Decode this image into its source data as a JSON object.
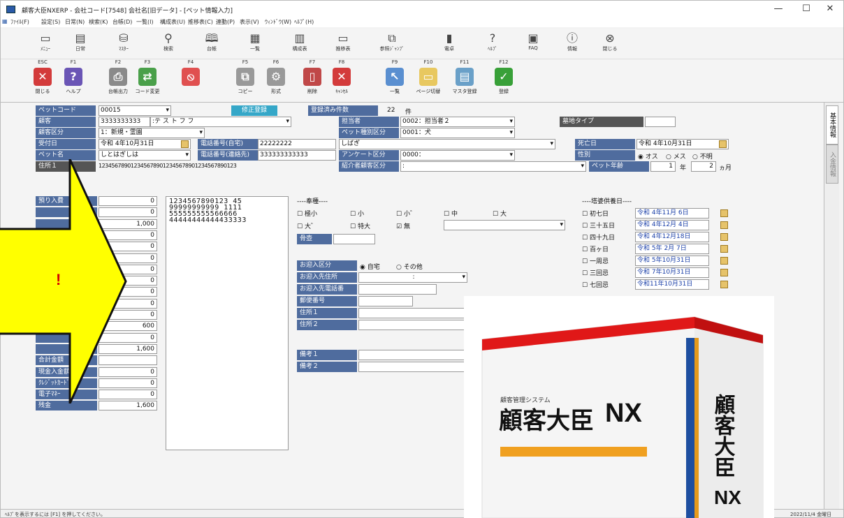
{
  "window": {
    "title": "顧客大臣NXERP - 会社コード[7548] 会社名[旧データ] - [ペット情報入力]",
    "min": "—",
    "max": "☐",
    "close": "✕"
  },
  "menu": [
    "ﾌｧｲﾙ(F)",
    "設定(S)",
    "日常(N)",
    "検索(K)",
    "台帳(D)",
    "一覧(I)",
    "構成表(U)",
    "推移表(C)",
    "連動(P)",
    "表示(V)",
    "ｳｨﾝﾄﾞｳ(W)",
    "ﾍﾙﾌﾟ(H)"
  ],
  "toolbar": [
    {
      "label": "ﾒﾆｭｰ",
      "icon": "menu-icon",
      "glyph": "▭"
    },
    {
      "label": "日常",
      "icon": "daily-icon",
      "glyph": "▤"
    },
    {
      "label": "ﾏｽﾀｰ",
      "icon": "master-icon",
      "glyph": "⛁"
    },
    {
      "label": "検索",
      "icon": "search-icon",
      "glyph": "⚲"
    },
    {
      "label": "台帳",
      "icon": "ledger-icon",
      "glyph": "🕮"
    },
    {
      "label": "一覧",
      "icon": "list-icon",
      "glyph": "▦"
    },
    {
      "label": "構成表",
      "icon": "structure-icon",
      "glyph": "▥"
    },
    {
      "label": "推移表",
      "icon": "trend-icon",
      "glyph": "▭"
    },
    {
      "label": "参照ｼﾞｬﾝﾌﾟ",
      "icon": "jump-icon",
      "glyph": "⧉"
    },
    {
      "label": "電卓",
      "icon": "calculator-icon",
      "glyph": "▮"
    },
    {
      "label": "ﾍﾙﾌﾟ",
      "icon": "help-icon",
      "glyph": "?"
    },
    {
      "label": "FAQ",
      "icon": "faq-icon",
      "glyph": "▣"
    },
    {
      "label": "情報",
      "icon": "info-icon",
      "glyph": "ⓘ"
    },
    {
      "label": "閉じる",
      "icon": "close-circle-icon",
      "glyph": "⊗"
    }
  ],
  "fkeys": [
    {
      "key": "ESC",
      "label": "閉じる",
      "icon": "exit-icon",
      "color": "#d33b3b",
      "glyph": "✕"
    },
    {
      "key": "F1",
      "label": "ヘルプ",
      "icon": "help-icon",
      "color": "#6a55b5",
      "glyph": "?"
    },
    {
      "key": "F2",
      "label": "台帳出力",
      "icon": "print-icon",
      "color": "#8a8a8a",
      "glyph": "⎙"
    },
    {
      "key": "F3",
      "label": "コード変更",
      "icon": "code-change-icon",
      "color": "#4aa04a",
      "glyph": "⇄"
    },
    {
      "key": "F4",
      "label": "",
      "icon": "prohibit-icon",
      "color": "#e05050",
      "glyph": "⦸"
    },
    {
      "key": "F5",
      "label": "コピー",
      "icon": "copy-icon",
      "color": "#999",
      "glyph": "⧉"
    },
    {
      "key": "F6",
      "label": "形式",
      "icon": "format-icon",
      "color": "#999",
      "glyph": "⚙"
    },
    {
      "key": "F7",
      "label": "削除",
      "icon": "delete-icon",
      "color": "#c04848",
      "glyph": "▯"
    },
    {
      "key": "F8",
      "label": "ｷｬﾝｾﾙ",
      "icon": "cancel-icon",
      "color": "#d33b3b",
      "glyph": "✕"
    },
    {
      "key": "F9",
      "label": "一覧",
      "icon": "list-view-icon",
      "color": "#5a8fd0",
      "glyph": "↖"
    },
    {
      "key": "F10",
      "label": "ページ切替",
      "icon": "page-switch-icon",
      "color": "#e8c860",
      "glyph": "▭"
    },
    {
      "key": "F11",
      "label": "マスタ登録",
      "icon": "master-register-icon",
      "color": "#6aa0c8",
      "glyph": "▤"
    },
    {
      "key": "F12",
      "label": "登録",
      "icon": "register-check-icon",
      "color": "#38a038",
      "glyph": "✓"
    }
  ],
  "form": {
    "pet_code_label": "ペットコード",
    "pet_code": "00015",
    "correction_badge": "修正登録",
    "registered_count_label": "登録済み件数",
    "registered_count": "22",
    "count_unit": "件",
    "customer_label": "顧客",
    "customer_code": "3333333333",
    "customer_name": ":テ ス ト フ フ",
    "staff_label": "担当者",
    "staff": "0002：担当者２",
    "grave_type_label": "墓地タイプ",
    "customer_class_label": "顧客区分",
    "customer_class": "1：新規・霊園",
    "pet_kind_label": "ペット種別区分",
    "pet_kind": "0001：犬",
    "reception_label": "受付日",
    "reception": "令和 4年10月31日",
    "phone_home_label": "電話番号(自宅)",
    "phone_home": "22222222",
    "breed": "しばぎ",
    "death_label": "死亡日",
    "death": "令和 4年10月31日",
    "pet_name_label": "ペット名",
    "pet_name": "しとはぎしは",
    "phone_contact_label": "電話番号(連絡先)",
    "phone_contact": "333333333333",
    "survey_label": "アンケート区分",
    "survey": "0000：",
    "sex_label": "性別",
    "sex_options": [
      "オス",
      "メス",
      "不明"
    ],
    "address1_label": "住所１",
    "address1": "1234567890123456789012345678901234567890123",
    "referrer_label": "紹介者顧客区分",
    "referrer": ":",
    "age_label": "ペット年齢",
    "age_years": "1",
    "age_years_unit": "年",
    "age_months": "2",
    "age_months_unit": "ヵ月"
  },
  "amounts": {
    "labels": [
      "預り入費",
      "",
      "",
      "",
      "",
      "",
      "",
      "",
      "",
      "",
      "",
      "",
      "",
      "",
      "合計金額",
      "現金入金額",
      "ｸﾚｼﾞｯﾄｶｰﾄﾞ",
      "電子ﾏﾈｰ",
      "残金"
    ],
    "values": [
      "0",
      "0",
      "1,000",
      "0",
      "0",
      "0",
      "0",
      "0",
      "0",
      "0",
      "0",
      "600",
      "0",
      "1,600",
      "",
      "0",
      "0",
      "0",
      "1,600"
    ]
  },
  "memo_lines": [
    "1234567890123 45",
    "99999999999 1111",
    "555555555566666",
    "44444444444433333"
  ],
  "offerings": {
    "title": "----奉種----",
    "items": [
      "極小",
      "小",
      "小゛",
      "中",
      "大",
      "大゛",
      "特大",
      "無"
    ],
    "checked": "無",
    "bone_label": "骨壺"
  },
  "pickup": {
    "class_label": "お迎入区分",
    "options": [
      "自宅",
      "その他"
    ],
    "selected": "自宅",
    "address_label": "お迎入先住所",
    "address_value": ":",
    "phone_label": "お迎入先電話番",
    "zip_label": "郵便番号",
    "addr1_label": "住所１",
    "addr2_label": "住所２",
    "note1_label": "備考１",
    "note2_label": "備考２"
  },
  "memorial": {
    "title": "----塔婆供養日----",
    "items": [
      {
        "name": "初七日",
        "date": "令和 4年11月 6日"
      },
      {
        "name": "三十五日",
        "date": "令和 4年12月 4日"
      },
      {
        "name": "四十九日",
        "date": "令和 4年12月18日"
      },
      {
        "name": "百ヶ日",
        "date": "令和 5年 2月 7日"
      },
      {
        "name": "一周忌",
        "date": "令和 5年10月31日"
      },
      {
        "name": "三回忌",
        "date": "令和 7年10月31日"
      },
      {
        "name": "七回忌",
        "date": "令和11年10月31日"
      }
    ]
  },
  "side_tabs": [
    "基本情報",
    "入金情報"
  ],
  "status": {
    "hint": "ﾍﾙﾌﾟを表示するには [F1] を押してください。",
    "date": "2022/11/4 金曜日"
  },
  "callout": {
    "text": "!",
    "fill": "#ffff00"
  },
  "product": {
    "subtitle": "顧客管理システム",
    "name": "顧客大臣",
    "suffix": "NX",
    "side": "顧客大臣",
    "side_suffix": "NX"
  }
}
